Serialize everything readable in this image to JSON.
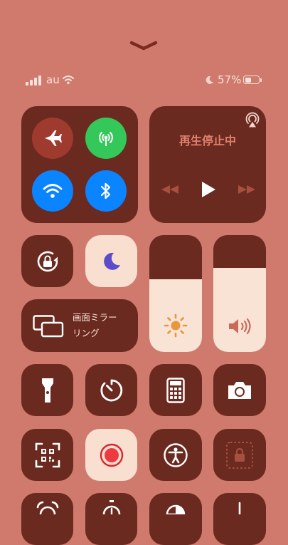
{
  "status_bar": {
    "carrier": "au",
    "battery_percent": "57%",
    "battery_level": 0.57
  },
  "connectivity": {
    "airplane_mode": {
      "icon": "airplane-icon",
      "on": false
    },
    "cellular_data": {
      "icon": "cellular-antenna-icon",
      "on": true
    },
    "wifi": {
      "icon": "wifi-icon",
      "on": true
    },
    "bluetooth": {
      "icon": "bluetooth-icon",
      "on": true
    }
  },
  "now_playing": {
    "status": "再生停止中",
    "airplay_icon": "airplay-icon",
    "controls": [
      "rewind-icon",
      "play-icon",
      "fast-forward-icon"
    ]
  },
  "orientation_lock": {
    "icon": "orientation-lock-icon"
  },
  "do_not_disturb": {
    "icon": "moon-icon",
    "on": true
  },
  "screen_mirroring": {
    "label": "画面ミラー\nリング",
    "icon": "screen-mirroring-icon"
  },
  "brightness": {
    "icon": "sun-icon",
    "level": 0.62
  },
  "volume": {
    "icon": "speaker-icon",
    "level": 0.72
  },
  "shortcuts_row1": [
    "flashlight-icon",
    "timer-icon",
    "calculator-icon",
    "camera-icon"
  ],
  "shortcuts_row2": [
    "qr-scanner-icon",
    "screen-record-icon",
    "accessibility-icon",
    "guided-access-lock-icon"
  ],
  "shortcuts_row3": [
    "alarm-icon",
    "stopwatch-icon",
    "dark-mode-icon",
    "text-size-icon"
  ],
  "colors": {
    "background": "#cf7a6c",
    "tile": "#6b2a1f",
    "accent_green": "#34c759",
    "accent_blue": "#0a84ff",
    "airplane_off": "#9e3a2e",
    "now_playing_text": "#e0806e",
    "light_tile": "#f8dfd0",
    "record_red": "#d9262e",
    "moon_purple": "#5d4cc9"
  }
}
